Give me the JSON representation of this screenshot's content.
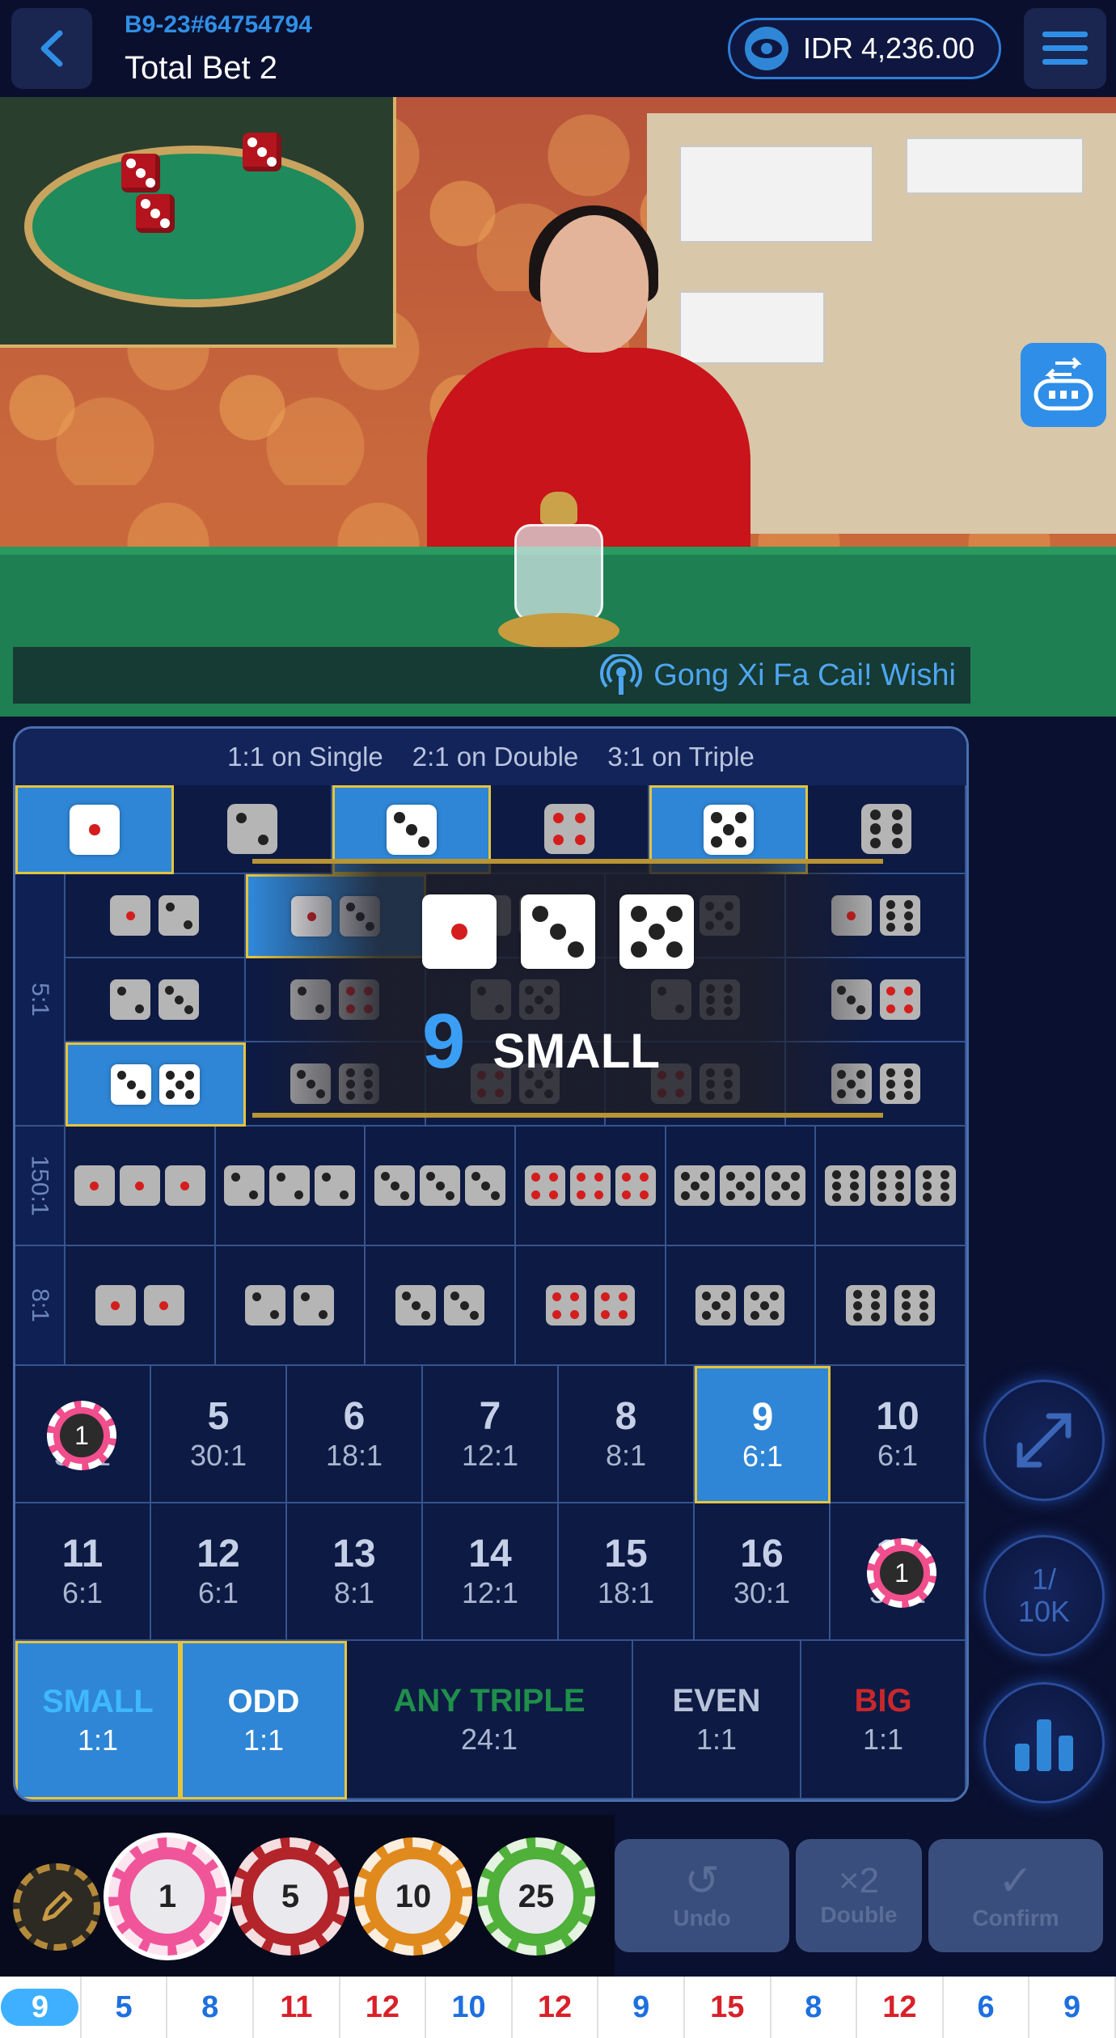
{
  "header": {
    "round_id": "B9-23#64754794",
    "total_bet": "Total Bet 2",
    "balance": "IDR 4,236.00"
  },
  "video": {
    "ticker_text": "Gong Xi Fa Cai! Wishi"
  },
  "board": {
    "payout_single": "1:1 on Single",
    "payout_double": "2:1 on Double",
    "payout_triple": "3:1 on Triple",
    "label_combo": "5:1",
    "label_triple": "150:1",
    "label_double": "8:1",
    "numbers_row1": [
      {
        "num": "4",
        "odds": "30:1"
      },
      {
        "num": "5",
        "odds": "30:1"
      },
      {
        "num": "6",
        "odds": "18:1"
      },
      {
        "num": "7",
        "odds": "12:1"
      },
      {
        "num": "8",
        "odds": "8:1"
      },
      {
        "num": "9",
        "odds": "6:1"
      },
      {
        "num": "10",
        "odds": "6:1"
      }
    ],
    "numbers_row2": [
      {
        "num": "11",
        "odds": "6:1"
      },
      {
        "num": "12",
        "odds": "6:1"
      },
      {
        "num": "13",
        "odds": "8:1"
      },
      {
        "num": "14",
        "odds": "12:1"
      },
      {
        "num": "15",
        "odds": "18:1"
      },
      {
        "num": "16",
        "odds": "30:1"
      },
      {
        "num": "17",
        "odds": "30:1"
      }
    ],
    "bottom": [
      {
        "label": "SMALL",
        "odds": "1:1",
        "color": "#3fb8ff"
      },
      {
        "label": "ODD",
        "odds": "1:1",
        "color": "#ffffff"
      },
      {
        "label": "ANY TRIPLE",
        "odds": "24:1",
        "color": "#1f8f4a"
      },
      {
        "label": "EVEN",
        "odds": "1:1",
        "color": "#b8c2d8"
      },
      {
        "label": "BIG",
        "odds": "1:1",
        "color": "#c7282c"
      }
    ],
    "placed_chip_value": "1"
  },
  "result": {
    "total": "9",
    "label": "SMALL",
    "dice": [
      1,
      3,
      5
    ]
  },
  "side": {
    "limit": "1/\n10K",
    "limit_top": "1/",
    "limit_bottom": "10K"
  },
  "chips": [
    {
      "value": "1",
      "color": "#f0559a"
    },
    {
      "value": "5",
      "color": "#b3242b"
    },
    {
      "value": "10",
      "color": "#e08a1e"
    },
    {
      "value": "25",
      "color": "#4fb03a"
    }
  ],
  "actions": {
    "undo": "Undo",
    "double": "Double",
    "double_icon": "×2",
    "confirm": "Confirm"
  },
  "history": [
    {
      "value": "9",
      "color": "#ffffff"
    },
    {
      "value": "5",
      "color": "#1e6fe0"
    },
    {
      "value": "8",
      "color": "#1e6fe0"
    },
    {
      "value": "11",
      "color": "#d9202a"
    },
    {
      "value": "12",
      "color": "#d9202a"
    },
    {
      "value": "10",
      "color": "#1e6fe0"
    },
    {
      "value": "12",
      "color": "#d9202a"
    },
    {
      "value": "9",
      "color": "#1e6fe0"
    },
    {
      "value": "15",
      "color": "#d9202a"
    },
    {
      "value": "8",
      "color": "#1e6fe0"
    },
    {
      "value": "12",
      "color": "#d9202a"
    },
    {
      "value": "6",
      "color": "#1e6fe0"
    },
    {
      "value": "9",
      "color": "#1e6fe0"
    }
  ],
  "colors": {
    "accent": "#2f86d6",
    "selected_border": "#e4c43f",
    "board_bg": "#0d1a44"
  }
}
